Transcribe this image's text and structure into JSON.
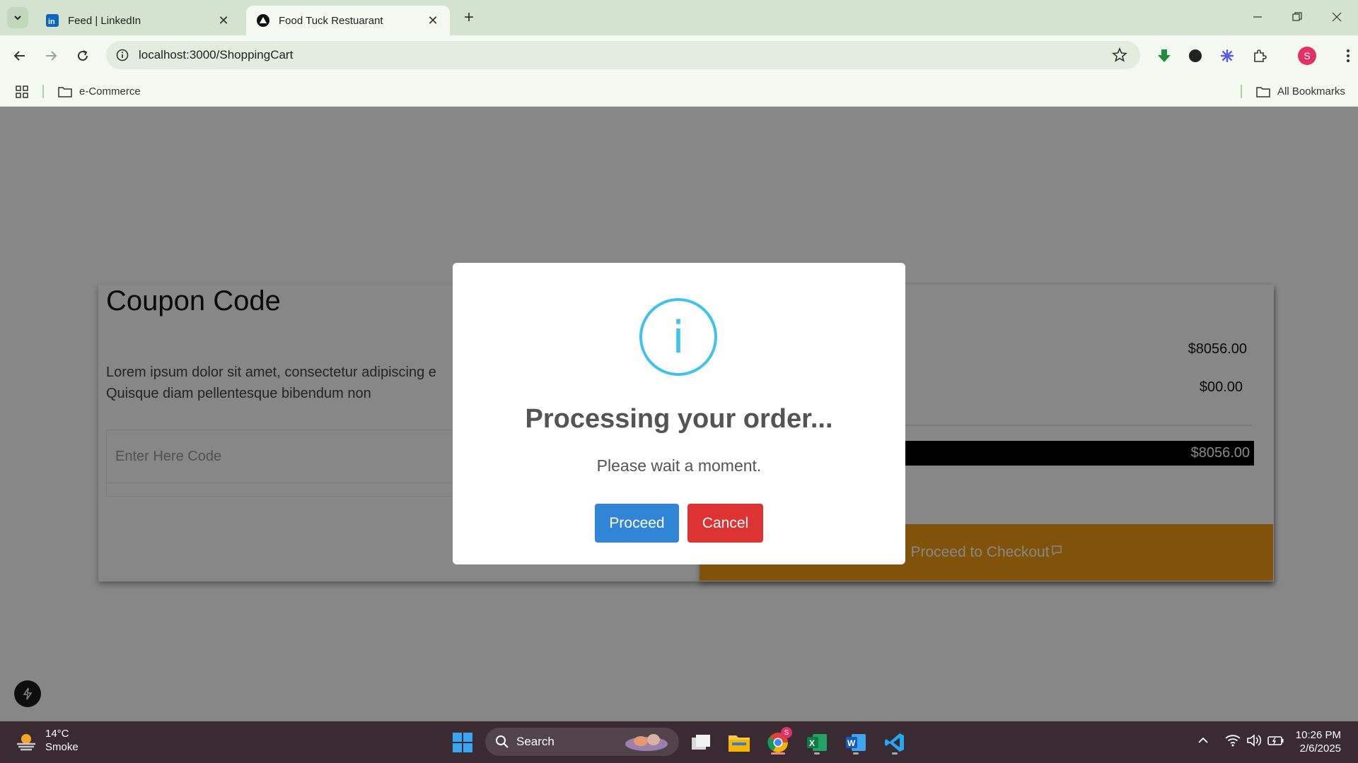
{
  "browser": {
    "tabs": [
      {
        "title": "Feed | LinkedIn",
        "favicon": "linkedin-icon",
        "active": false
      },
      {
        "title": "Food Tuck Restuarant",
        "favicon": "nextjs-icon",
        "active": true
      }
    ],
    "url": "localhost:3000/ShoppingCart",
    "bookmarks": [
      {
        "label": "e-Commerce"
      },
      {
        "label": "All Bookmarks"
      }
    ],
    "profile_initial": "S"
  },
  "page": {
    "coupon_title": "Coupon Code",
    "coupon_text": "Lorem ipsum dolor sit amet, consectetur adipiscing e Quisque diam pellentesque bibendum non",
    "coupon_placeholder": "Enter Here Code",
    "subtotal": "$8056.00",
    "delivery": "$00.00",
    "total": "$8056.00",
    "checkout_label": "Proceed to Checkout"
  },
  "modal": {
    "icon": "info-icon",
    "icon_glyph": "i",
    "title": "Processing your order...",
    "text": "Please wait a moment.",
    "proceed_label": "Proceed",
    "cancel_label": "Cancel",
    "colors": {
      "proceed": "#3085d6",
      "cancel": "#dd3333",
      "info": "#3fc3ee"
    }
  },
  "taskbar": {
    "weather_temp": "14°C",
    "weather_desc": "Smoke",
    "search_label": "Search",
    "time": "10:26 PM",
    "date": "2/6/2025",
    "chrome_badge": "S"
  },
  "colors": {
    "checkout": "#f39c12",
    "tabbar": "#d3e3cd",
    "toolbar": "#f4f9f1"
  }
}
